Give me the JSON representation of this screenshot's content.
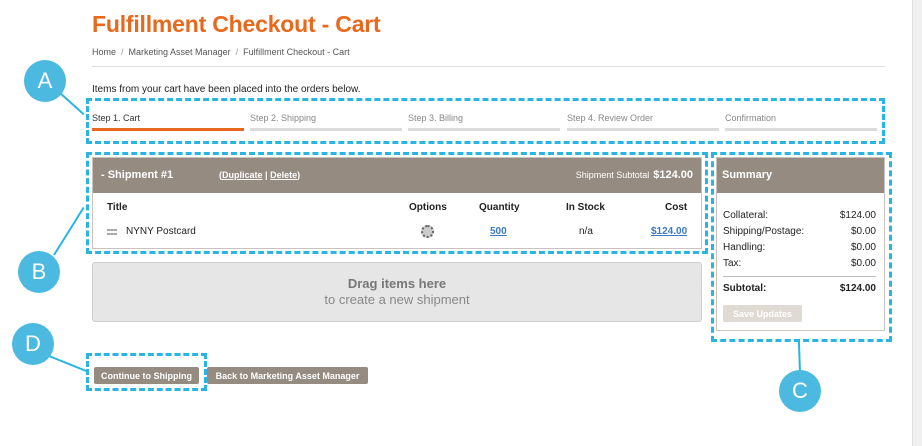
{
  "page": {
    "title": "Fulfillment Checkout - Cart"
  },
  "breadcrumb": [
    "Home",
    "Marketing Asset Manager",
    "Fulfillment Checkout - Cart"
  ],
  "intro": "Items from your cart have been placed into the orders below.",
  "steps": [
    {
      "label": "Step 1. Cart",
      "active": true
    },
    {
      "label": "Step 2. Shipping",
      "active": false
    },
    {
      "label": "Step 3. Billing",
      "active": false
    },
    {
      "label": "Step 4. Review Order",
      "active": false
    },
    {
      "label": "Confirmation",
      "active": false
    }
  ],
  "shipment": {
    "title": "- Shipment #1",
    "duplicate": "Duplicate",
    "delete": "Delete",
    "link_sep": "|",
    "subtotal_label": "Shipment Subtotal",
    "subtotal_value": "$124.00",
    "columns": {
      "title": "Title",
      "options": "Options",
      "quantity": "Quantity",
      "in_stock": "In Stock",
      "cost": "Cost"
    },
    "items": [
      {
        "title": "NYNY Postcard",
        "quantity": "500",
        "in_stock": "n/a",
        "cost": "$124.00"
      }
    ]
  },
  "dropzone": {
    "title": "Drag items here",
    "subtitle": "to create a new shipment"
  },
  "summary": {
    "title": "Summary",
    "rows": [
      {
        "label": "Collateral:",
        "value": "$124.00"
      },
      {
        "label": "Shipping/Postage:",
        "value": "$0.00"
      },
      {
        "label": "Handling:",
        "value": "$0.00"
      },
      {
        "label": "Tax:",
        "value": "$0.00"
      }
    ],
    "subtotal_label": "Subtotal:",
    "subtotal_value": "$124.00",
    "save_label": "Save Updates"
  },
  "buttons": {
    "continue": "Continue to Shipping",
    "back": "Back to Marketing Asset Manager"
  },
  "callouts": [
    "A",
    "B",
    "C",
    "D"
  ],
  "colors": {
    "accent": "#e8681d",
    "header_bg": "#958b80",
    "callout": "#29b5e3",
    "link": "#3a78c0"
  }
}
